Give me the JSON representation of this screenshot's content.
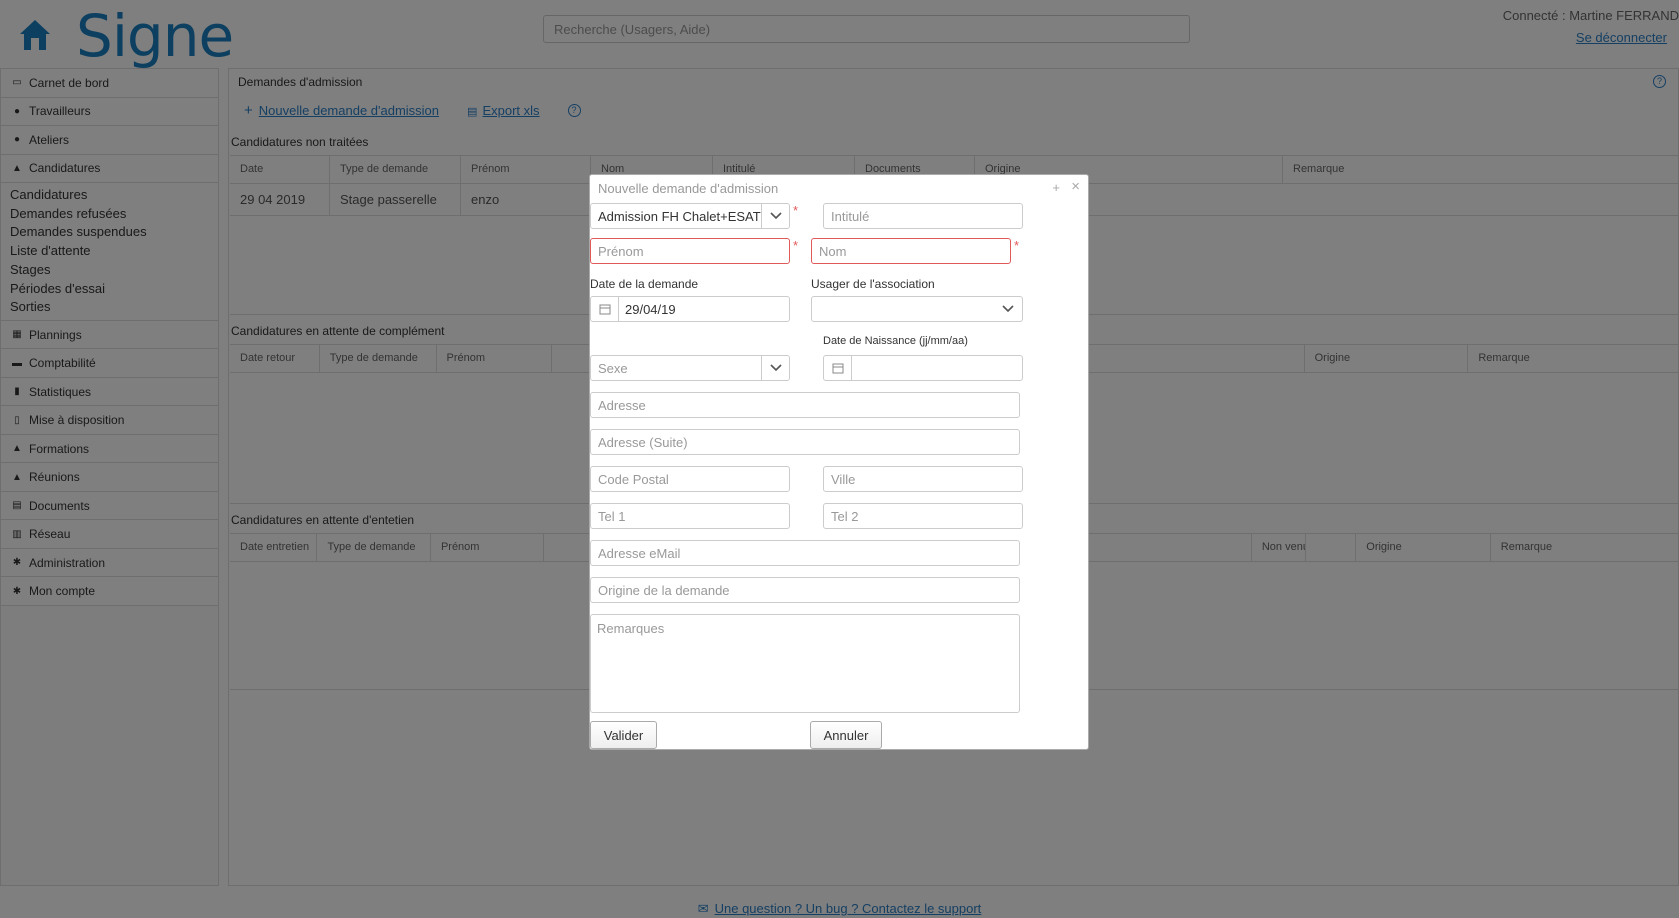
{
  "app": {
    "logo_text": "Signe",
    "search_placeholder": "Recherche (Usagers, Aide)",
    "connected_user": "Connecté : Martine FERRAND",
    "logout": "Se déconnecter"
  },
  "sidebar": {
    "items": [
      {
        "label": "Carnet de bord",
        "icon": "book-icon"
      },
      {
        "label": "Travailleurs",
        "icon": "users-icon"
      },
      {
        "label": "Ateliers",
        "icon": "user-icon"
      },
      {
        "label": "Candidatures",
        "icon": "graduation-icon"
      },
      {
        "label": "Plannings",
        "icon": "calendar-icon"
      },
      {
        "label": "Comptabilité",
        "icon": "money-icon"
      },
      {
        "label": "Statistiques",
        "icon": "bar-chart-icon"
      },
      {
        "label": "Mise à disposition",
        "icon": "file-icon"
      },
      {
        "label": "Formations",
        "icon": "graduation-icon"
      },
      {
        "label": "Réunions",
        "icon": "graduation-icon"
      },
      {
        "label": "Documents",
        "icon": "folder-icon"
      },
      {
        "label": "Réseau",
        "icon": "network-icon"
      },
      {
        "label": "Administration",
        "icon": "cogs-icon"
      },
      {
        "label": "Mon compte",
        "icon": "gear-icon"
      }
    ],
    "subitems": [
      "Candidatures",
      "Demandes refusées",
      "Demandes suspendues",
      "Liste d'attente",
      "Stages",
      "Périodes d'essai",
      "Sorties"
    ]
  },
  "main": {
    "title": "Demandes d'admission",
    "new_request": "Nouvelle demande d'admission",
    "export": "Export xls",
    "help": "?",
    "section1": {
      "title": "Candidatures non traitées",
      "headers": [
        "Date",
        "Type de demande",
        "Prénom",
        "Nom",
        "Intitulé",
        "Documents",
        "Origine",
        "Remarque"
      ],
      "row": [
        "29 04 2019",
        "Stage passerelle",
        "enzo"
      ]
    },
    "section2": {
      "title": "Candidatures en attente de complément",
      "headers": [
        "Date retour",
        "Type de demande",
        "Prénom",
        "Origine",
        "Remarque"
      ]
    },
    "section3": {
      "title": "Candidatures en attente d'entetien",
      "headers": [
        "Date entretien",
        "Type de demande",
        "Prénom",
        "Non venu",
        "Origine",
        "Remarque"
      ]
    }
  },
  "footer": {
    "support": "Une question ? Un bug ? Contactez le support"
  },
  "modal": {
    "title": "Nouvelle demande d'admission",
    "max_icon": "+",
    "close_icon": "×",
    "type_value": "Admission FH Chalet+ESAT",
    "required_mark": "*",
    "intitule_ph": "Intitulé",
    "prenom_ph": "Prénom",
    "nom_ph": "Nom",
    "date_label": "Date de la demande",
    "date_value": "29/04/19",
    "usager_label": "Usager de l'association",
    "sexe_ph": "Sexe",
    "naissance_label": "Date de Naissance (jj/mm/aa)",
    "adresse_ph": "Adresse",
    "adresse2_ph": "Adresse (Suite)",
    "cp_ph": "Code Postal",
    "ville_ph": "Ville",
    "tel1_ph": "Tel 1",
    "tel2_ph": "Tel 2",
    "email_ph": "Adresse eMail",
    "origine_ph": "Origine de la demande",
    "remarques_ph": "Remarques",
    "valider": "Valider",
    "annuler": "Annuler"
  }
}
